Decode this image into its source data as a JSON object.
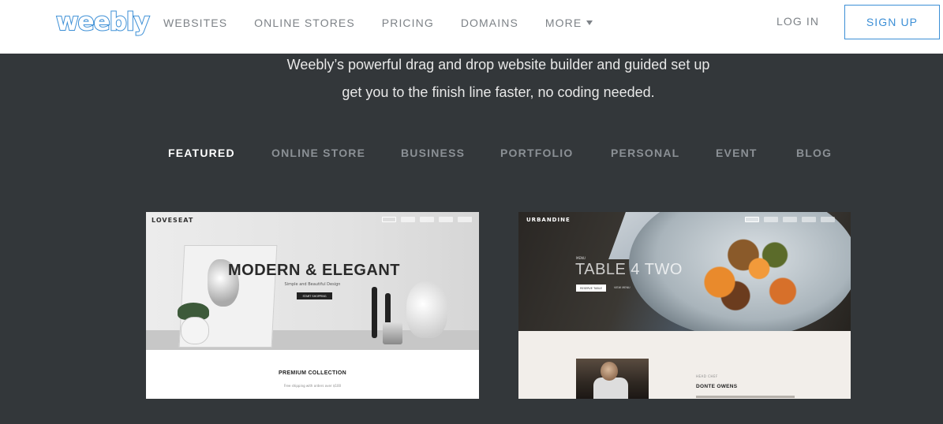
{
  "header": {
    "logo": "weebly",
    "nav": [
      "WEBSITES",
      "ONLINE STORES",
      "PRICING",
      "DOMAINS",
      "MORE"
    ],
    "login": "LOG IN",
    "signup": "SIGN UP",
    "accent_color": "#3c8fd6",
    "icons": {
      "more_caret": "caret-down-icon"
    }
  },
  "hero": {
    "line1": "Weebly’s powerful drag and drop website builder and guided set up",
    "line2": "get you to the finish line faster, no coding needed."
  },
  "tabs": {
    "items": [
      "FEATURED",
      "ONLINE STORE",
      "BUSINESS",
      "PORTFOLIO",
      "PERSONAL",
      "EVENT",
      "BLOG"
    ],
    "active": "FEATURED"
  },
  "templates": [
    {
      "brand": "LOVESEAT",
      "headline": "MODERN & ELEGANT",
      "subline": "Simple and Beautiful Design",
      "button": "START SHOPPING",
      "section_title": "PREMIUM COLLECTION",
      "section_text": "Free shipping with orders over $100"
    },
    {
      "brand": "URBANDINE",
      "kicker": "MENU",
      "headline": "TABLE 4 TWO",
      "button": "RESERVE TABLE",
      "link": "VIEW MENU",
      "section_label": "HEAD CHEF",
      "section_title": "DONTE OWENS"
    }
  ],
  "colors": {
    "page_bg": "#33373a",
    "header_bg": "#ffffff",
    "nav_text": "#7d8287",
    "tab_inactive": "#8b9095",
    "tab_active": "#ffffff"
  }
}
